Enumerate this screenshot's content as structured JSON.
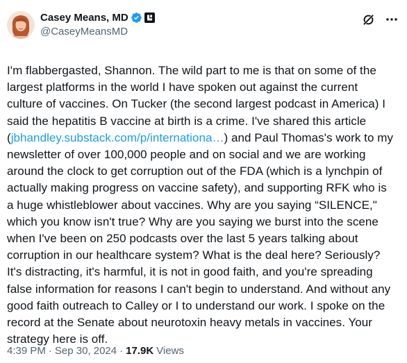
{
  "author": {
    "display_name": "Casey Means, MD",
    "handle": "@CaseyMeansMD"
  },
  "tweet": {
    "text_part1": "I'm flabbergasted, Shannon. The wild part to me is that on some of the largest platforms in the world I have spoken out against the current culture of vaccines. On Tucker (the second largest podcast in America) I said the hepatitis B vaccine at birth is a crime. I've shared this article (",
    "link_text": "jbhandley.substack.com/p/internationa…",
    "text_part2": ") and Paul Thomas's work to my newsletter of over 100,000 people and on social and we are working around the clock to get corruption out of the FDA (which is a lynchpin of actually making progress on vaccine safety), and supporting RFK who is a huge whistleblower about vaccines. Why are you saying “SILENCE,\" which you know isn't true? Why are you saying we burst into the scene when I've been on 250 podcasts over the last 5 years talking about corruption in our healthcare system? What is the deal here? Seriously? It's distracting, it's harmful, it is not in good faith, and you're spreading false information for reasons I can't begin to understand. And without any good faith outreach to Calley or I to understand our work. I spoke on the record at the Senate about neurotoxin heavy metals in vaccines. Your strategy here is off."
  },
  "meta": {
    "time": "4:39 PM",
    "separator": "·",
    "date": "Sep 30, 2024",
    "views_count": "17.9K",
    "views_label": "Views"
  },
  "icons": {
    "verified": "verified-badge-icon",
    "affiliate": "affiliate-badge-icon",
    "grok": "grok-icon",
    "more": "more-options-icon"
  },
  "colors": {
    "text": "#0f1419",
    "secondary": "#536471",
    "link": "#1d9bf0",
    "verified": "#1d9bf0"
  }
}
